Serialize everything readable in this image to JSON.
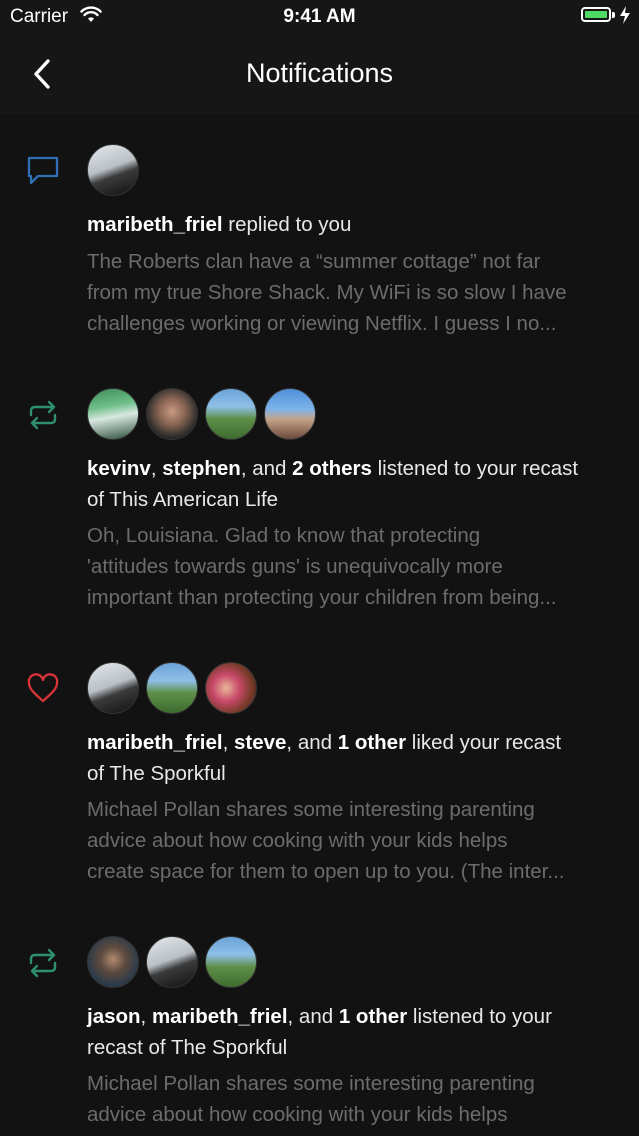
{
  "status_bar": {
    "carrier": "Carrier",
    "time": "9:41 AM"
  },
  "nav": {
    "title": "Notifications",
    "back_icon": "chevron-left-icon"
  },
  "colors": {
    "reply_icon": "#2f6fb5",
    "recast_icon": "#2f8f6f",
    "like_icon": "#d9343a",
    "battery": "#4cd964"
  },
  "notifications": [
    {
      "type": "reply",
      "icon": "speech-bubble-icon",
      "user1": "maribeth_friel",
      "action": " replied to you",
      "snippet_lines": [
        "The Roberts clan have a “summer cottage” not far",
        "from my true Shore Shack. My WiFi is so slow I have",
        "challenges working or viewing Netflix. I guess I no..."
      ]
    },
    {
      "type": "recast",
      "icon": "recast-arrows-icon",
      "user1": "kevinv",
      "sep1": ", ",
      "user2": "stephen",
      "sep2": ", and ",
      "others": "2 others",
      "action_line1": " listened to your recast",
      "action_line2": "of This American Life",
      "snippet_lines": [
        "Oh, Louisiana. Glad to know that protecting",
        "'attitudes towards guns' is unequivocally more",
        "important than protecting your children from being..."
      ]
    },
    {
      "type": "like",
      "icon": "heart-icon",
      "user1": "maribeth_friel",
      "sep1": ", ",
      "user2": "steve",
      "sep2": ", and ",
      "others": "1 other",
      "action_line1": " liked your recast",
      "action_line2": "of The Sporkful",
      "snippet_lines": [
        "Michael Pollan shares some interesting parenting",
        "advice about how cooking with your kids helps",
        "create space for them to open up to you. (The inter..."
      ]
    },
    {
      "type": "recast",
      "icon": "recast-arrows-icon",
      "user1": "jason",
      "sep1": ", ",
      "user2": "maribeth_friel",
      "sep2": ", and ",
      "others": "1 other",
      "action_line1": " listened to your",
      "action_line2": "recast of The Sporkful",
      "snippet_lines": [
        "Michael Pollan shares some interesting parenting",
        "advice about how cooking with your kids helps"
      ]
    }
  ]
}
